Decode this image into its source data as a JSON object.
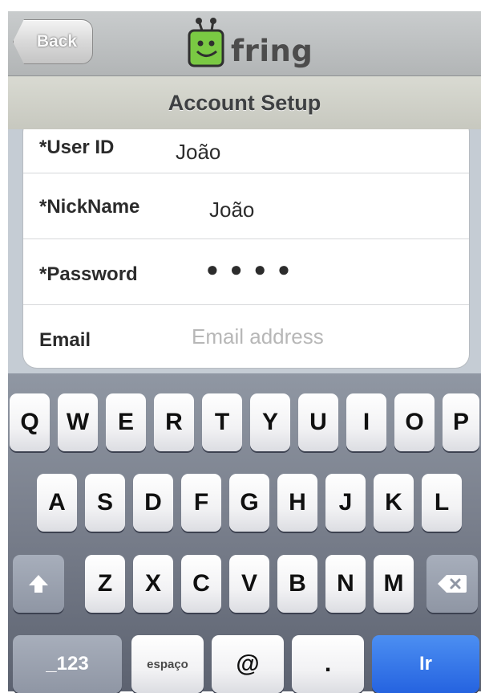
{
  "navbar": {
    "back_label": "Back",
    "logo_text": "fring",
    "logo_color": "#7ac943"
  },
  "title": "Account Setup",
  "form": {
    "user_id": {
      "label": "*User ID",
      "value": "João"
    },
    "nickname": {
      "label": "*NickName",
      "value": "João"
    },
    "password": {
      "label": "*Password",
      "value": "●●●●"
    },
    "email": {
      "label": "Email",
      "value": "",
      "placeholder": "Email address"
    }
  },
  "keyboard": {
    "row1": [
      "Q",
      "W",
      "E",
      "R",
      "T",
      "Y",
      "U",
      "I",
      "O",
      "P"
    ],
    "row2": [
      "A",
      "S",
      "D",
      "F",
      "G",
      "H",
      "J",
      "K",
      "L"
    ],
    "row3": [
      "Z",
      "X",
      "C",
      "V",
      "B",
      "N",
      "M"
    ],
    "shift_icon": "shift-arrow-icon",
    "backspace_icon": "backspace-icon",
    "numbers_label": "_123",
    "space_label": "espaço",
    "at_label": "@",
    "dot_label": ".",
    "go_label": "Ir",
    "go_color": "#2d6fe8"
  }
}
